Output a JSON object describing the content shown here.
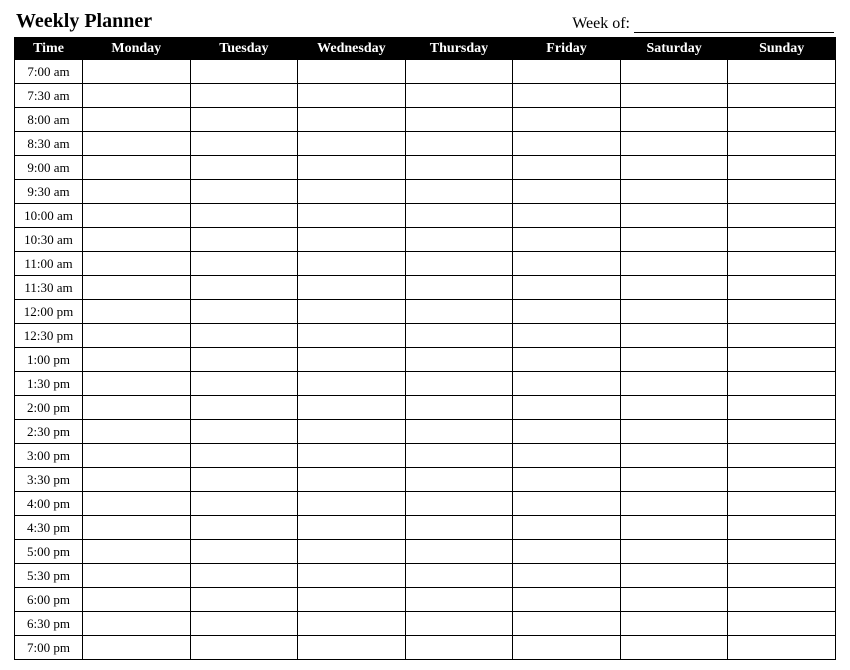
{
  "header": {
    "title": "Weekly Planner",
    "week_of_label": "Week of:",
    "week_of_value": ""
  },
  "columns": {
    "time": "Time",
    "days": [
      "Monday",
      "Tuesday",
      "Wednesday",
      "Thursday",
      "Friday",
      "Saturday",
      "Sunday"
    ]
  },
  "times": [
    "7:00 am",
    "7:30 am",
    "8:00 am",
    "8:30 am",
    "9:00 am",
    "9:30 am",
    "10:00 am",
    "10:30 am",
    "11:00 am",
    "11:30 am",
    "12:00 pm",
    "12:30 pm",
    "1:00 pm",
    "1:30 pm",
    "2:00 pm",
    "2:30 pm",
    "3:00 pm",
    "3:30 pm",
    "4:00 pm",
    "4:30 pm",
    "5:00 pm",
    "5:30 pm",
    "6:00 pm",
    "6:30 pm",
    "7:00 pm"
  ]
}
